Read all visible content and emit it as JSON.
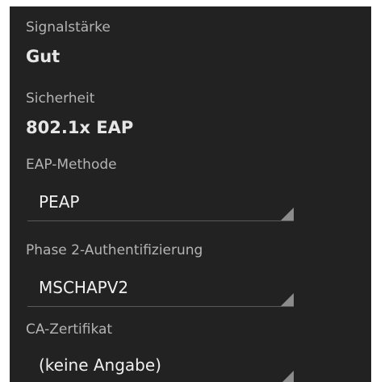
{
  "signal": {
    "label": "Signalstärke",
    "value": "Gut"
  },
  "security": {
    "label": "Sicherheit",
    "value": "802.1x EAP"
  },
  "eap_method": {
    "label": "EAP-Methode",
    "selected": "PEAP"
  },
  "phase2": {
    "label": "Phase 2-Authentifizierung",
    "selected": "MSCHAPV2"
  },
  "ca_cert": {
    "label": "CA-Zertifikat",
    "selected": "(keine Angabe)"
  },
  "icons": {
    "dropdown": "dropdown-triangle-icon"
  },
  "colors": {
    "background": "#222222",
    "label_text": "#b4b4b4",
    "value_text": "#e6e6e6",
    "spinner_arrow": "#8c8c8c"
  }
}
